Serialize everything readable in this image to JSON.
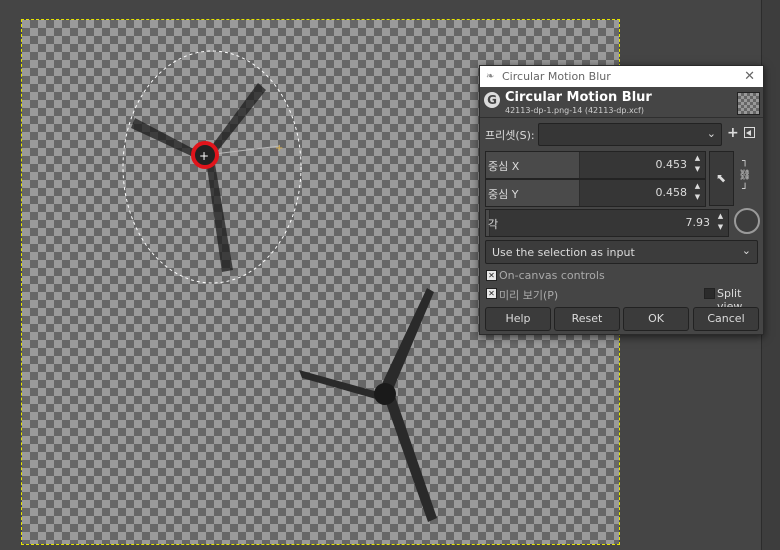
{
  "dialog": {
    "window_title": "Circular Motion Blur",
    "title": "Circular Motion Blur",
    "subtitle": "42113-dp-1.png-14 (42113-dp.xcf)",
    "presets": {
      "label": "프리셋(S):",
      "value": ""
    },
    "fields": [
      {
        "label": "중심 X",
        "value": "0.453"
      },
      {
        "label": "중심 Y",
        "value": "0.458"
      },
      {
        "label": "각",
        "value": "7.93"
      }
    ],
    "input_mode": "Use the selection as input",
    "on_canvas_controls": {
      "label": "On-canvas controls",
      "checked": true
    },
    "preview": {
      "label": "미리 보기(P)",
      "checked": true
    },
    "split_view": {
      "label": "Split view",
      "checked": false
    },
    "buttons": {
      "help": "Help",
      "reset": "Reset",
      "ok": "OK",
      "cancel": "Cancel"
    }
  },
  "icons": {
    "gimp": "G",
    "close": "✕",
    "chevron": "⌄",
    "plus": "+",
    "pointer": "⬉",
    "check": "✕"
  },
  "colors": {
    "highlight_circle": "#e0141b",
    "selection_border": "#e6e600",
    "titlebar": "#ffffff"
  }
}
